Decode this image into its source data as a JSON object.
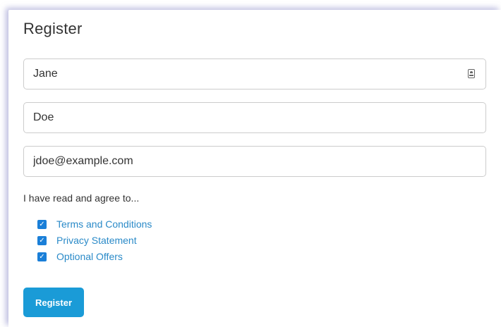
{
  "form": {
    "title": "Register",
    "fields": {
      "first_name": {
        "value": "Jane",
        "icon": "contact-card-icon"
      },
      "last_name": {
        "value": "Doe"
      },
      "email": {
        "value": "jdoe@example.com"
      }
    },
    "agree_label": "I have read and agree to...",
    "checkboxes": [
      {
        "label": "Terms and Conditions",
        "checked": true
      },
      {
        "label": "Privacy Statement",
        "checked": true
      },
      {
        "label": "Optional Offers",
        "checked": true
      }
    ],
    "submit_label": "Register"
  },
  "colors": {
    "checkbox_accent": "#1a7fd8",
    "link": "#2a8ac8",
    "button": "#1a9bd7",
    "text": "#333333",
    "border": "#cccccc"
  }
}
